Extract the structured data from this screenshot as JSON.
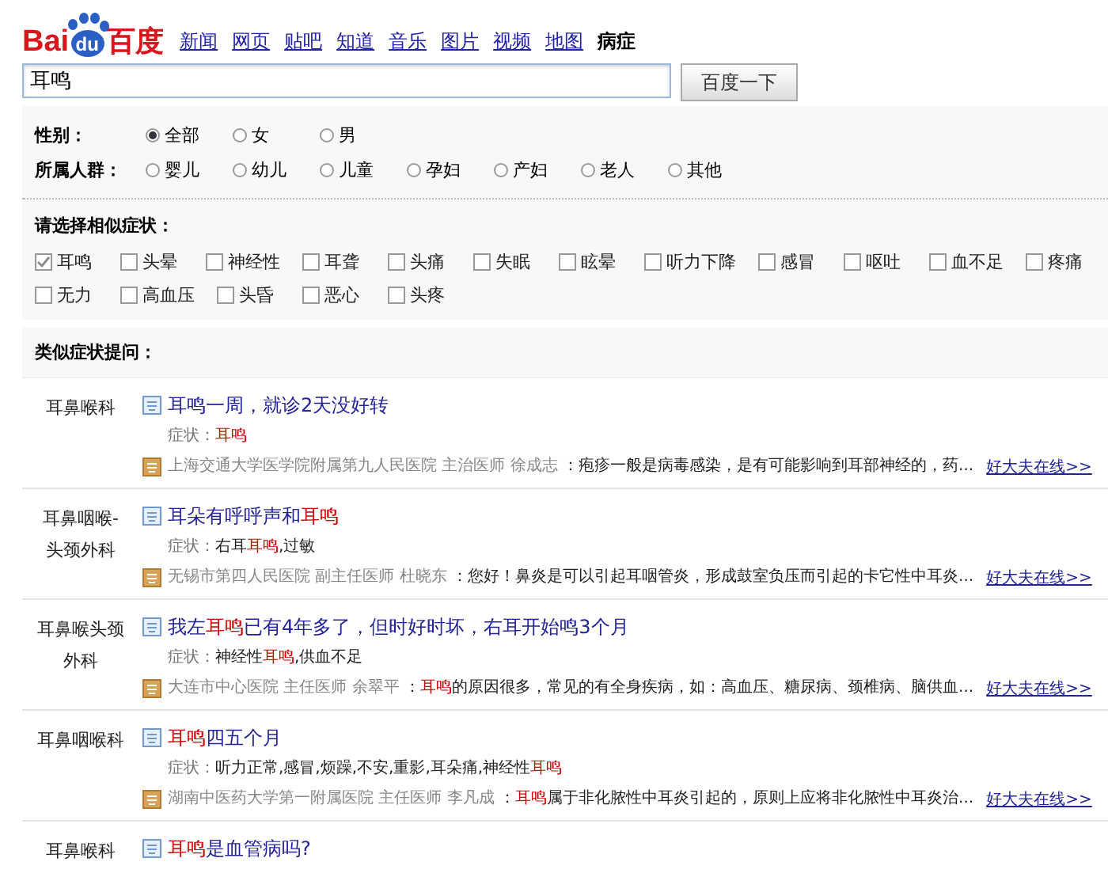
{
  "logo": {
    "left": "Bai",
    "paw": "du",
    "right": "百度"
  },
  "nav": [
    {
      "label": "新闻",
      "selected": false
    },
    {
      "label": "网页",
      "selected": false
    },
    {
      "label": "贴吧",
      "selected": false
    },
    {
      "label": "知道",
      "selected": false
    },
    {
      "label": "音乐",
      "selected": false
    },
    {
      "label": "图片",
      "selected": false
    },
    {
      "label": "视频",
      "selected": false
    },
    {
      "label": "地图",
      "selected": false
    },
    {
      "label": "病症",
      "selected": true
    }
  ],
  "search": {
    "value": "耳鸣",
    "button": "百度一下"
  },
  "filters": [
    {
      "label": "性别：",
      "options": [
        {
          "label": "全部",
          "selected": true
        },
        {
          "label": "女",
          "selected": false
        },
        {
          "label": "男",
          "selected": false
        }
      ]
    },
    {
      "label": "所属人群：",
      "options": [
        {
          "label": "婴儿",
          "selected": false
        },
        {
          "label": "幼儿",
          "selected": false
        },
        {
          "label": "儿童",
          "selected": false
        },
        {
          "label": "孕妇",
          "selected": false
        },
        {
          "label": "产妇",
          "selected": false
        },
        {
          "label": "老人",
          "selected": false
        },
        {
          "label": "其他",
          "selected": false
        }
      ]
    }
  ],
  "symptoms": {
    "heading": "请选择相似症状：",
    "items": [
      {
        "label": "耳鸣",
        "checked": true
      },
      {
        "label": "头晕",
        "checked": false
      },
      {
        "label": "神经性",
        "checked": false
      },
      {
        "label": "耳聋",
        "checked": false
      },
      {
        "label": "头痛",
        "checked": false
      },
      {
        "label": "失眠",
        "checked": false
      },
      {
        "label": "眩晕",
        "checked": false
      },
      {
        "label": "听力下降",
        "checked": false
      },
      {
        "label": "感冒",
        "checked": false
      },
      {
        "label": "呕吐",
        "checked": false
      },
      {
        "label": "血不足",
        "checked": false
      },
      {
        "label": "疼痛",
        "checked": false
      },
      {
        "label": "无力",
        "checked": false
      },
      {
        "label": "高血压",
        "checked": false
      },
      {
        "label": "头昏",
        "checked": false
      },
      {
        "label": "恶心",
        "checked": false
      },
      {
        "label": "头疼",
        "checked": false
      }
    ]
  },
  "questions": {
    "heading": "类似症状提问：",
    "items": [
      {
        "department": "耳鼻喉科",
        "title": [
          {
            "text": "耳鸣一周，就诊2天没好转",
            "highlight": false
          }
        ],
        "symptoms_label": "症状：",
        "symptoms": [
          {
            "text": "耳鸣",
            "highlight": true
          }
        ],
        "source": "上海交通大学医学院附属第九人民医院 主治医师 徐成志",
        "answer": [
          {
            "text": "：疱疹一般是病毒感染，是有可能影响到耳部神经的，药...",
            "highlight": false
          }
        ],
        "link": "好大夫在线>>"
      },
      {
        "department": "耳鼻咽喉-头颈外科",
        "title": [
          {
            "text": "耳朵有呼呼声和",
            "highlight": false
          },
          {
            "text": "耳鸣",
            "highlight": true
          }
        ],
        "symptoms_label": "症状：",
        "symptoms": [
          {
            "text": "右耳",
            "highlight": false
          },
          {
            "text": "耳鸣",
            "highlight": true
          },
          {
            "text": ",过敏",
            "highlight": false
          }
        ],
        "source": "无锡市第四人民医院 副主任医师 杜晓东",
        "answer": [
          {
            "text": "：您好！鼻炎是可以引起耳咽管炎，形成鼓室负压而引起的卡它性中耳炎...",
            "highlight": false
          }
        ],
        "link": "好大夫在线>>"
      },
      {
        "department": "耳鼻喉头颈外科",
        "title": [
          {
            "text": "我左",
            "highlight": false
          },
          {
            "text": "耳鸣",
            "highlight": true
          },
          {
            "text": "已有4年多了，但时好时坏，右耳开始鸣3个月",
            "highlight": false
          }
        ],
        "symptoms_label": "症状：",
        "symptoms": [
          {
            "text": "神经性",
            "highlight": false
          },
          {
            "text": "耳鸣",
            "highlight": true
          },
          {
            "text": ",供血不足",
            "highlight": false
          }
        ],
        "source": "大连市中心医院 主任医师 余翠平",
        "answer": [
          {
            "text": "：",
            "highlight": false
          },
          {
            "text": "耳鸣",
            "highlight": true
          },
          {
            "text": "的原因很多，常见的有全身疾病，如：高血压、糖尿病、颈椎病、脑供血...",
            "highlight": false
          }
        ],
        "link": "好大夫在线>>"
      },
      {
        "department": "耳鼻咽喉科",
        "title": [
          {
            "text": "耳鸣",
            "highlight": true
          },
          {
            "text": "四五个月",
            "highlight": false
          }
        ],
        "symptoms_label": "症状：",
        "symptoms": [
          {
            "text": "听力正常,感冒,烦躁,不安,重影,耳朵痛,神经性",
            "highlight": false
          },
          {
            "text": "耳鸣",
            "highlight": true
          }
        ],
        "source": "湖南中医药大学第一附属医院 主任医师 李凡成",
        "answer": [
          {
            "text": "：",
            "highlight": false
          },
          {
            "text": "耳鸣",
            "highlight": true
          },
          {
            "text": "属于非化脓性中耳炎引起的，原则上应将非化脓性中耳炎治...",
            "highlight": false
          }
        ],
        "link": "好大夫在线>>"
      },
      {
        "department": "耳鼻喉科",
        "title": [
          {
            "text": "耳鸣",
            "highlight": true
          },
          {
            "text": "是血管病吗?",
            "highlight": false
          }
        ]
      }
    ]
  }
}
